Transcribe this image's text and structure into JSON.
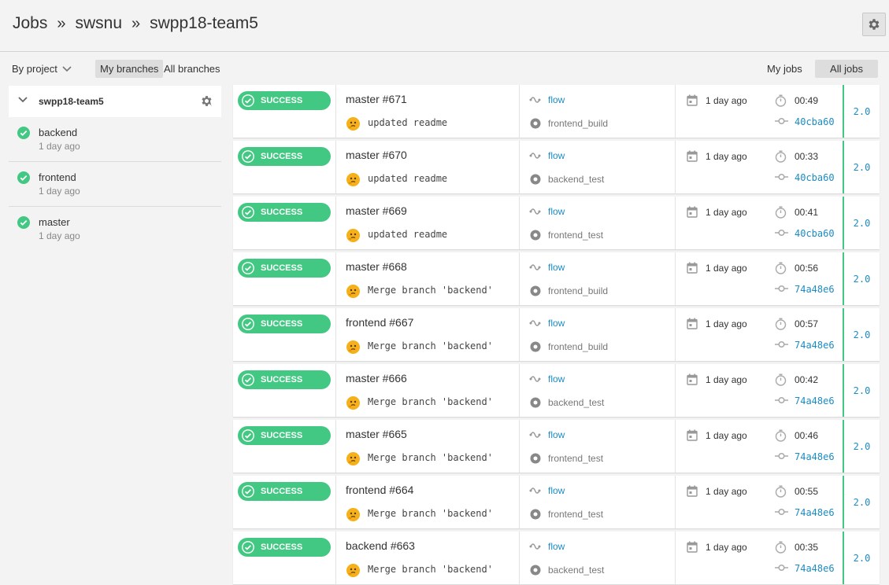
{
  "breadcrumb": [
    "Jobs",
    "swsnu",
    "swpp18-team5"
  ],
  "breadcrumb_sep": "»",
  "filters": {
    "by_project": "By project",
    "my_branches": "My branches",
    "all_branches": "All branches",
    "my_jobs": "My jobs",
    "all_jobs": "All jobs"
  },
  "sidebar": {
    "project": "swpp18-team5",
    "branches": [
      {
        "name": "backend",
        "time": "1 day ago"
      },
      {
        "name": "frontend",
        "time": "1 day ago"
      },
      {
        "name": "master",
        "time": "1 day ago"
      }
    ]
  },
  "colors": {
    "success": "#42c882",
    "link": "#1b8bc2"
  },
  "jobs": [
    {
      "status": "SUCCESS",
      "title": "master #671",
      "commit": "updated readme",
      "flow": "flow",
      "stage": "frontend_build",
      "date": "1 day ago",
      "duration": "00:49",
      "sha": "40cba60",
      "version": "2.0"
    },
    {
      "status": "SUCCESS",
      "title": "master #670",
      "commit": "updated readme",
      "flow": "flow",
      "stage": "backend_test",
      "date": "1 day ago",
      "duration": "00:33",
      "sha": "40cba60",
      "version": "2.0"
    },
    {
      "status": "SUCCESS",
      "title": "master #669",
      "commit": "updated readme",
      "flow": "flow",
      "stage": "frontend_test",
      "date": "1 day ago",
      "duration": "00:41",
      "sha": "40cba60",
      "version": "2.0"
    },
    {
      "status": "SUCCESS",
      "title": "master #668",
      "commit": "Merge branch 'backend'",
      "flow": "flow",
      "stage": "frontend_build",
      "date": "1 day ago",
      "duration": "00:56",
      "sha": "74a48e6",
      "version": "2.0"
    },
    {
      "status": "SUCCESS",
      "title": "frontend #667",
      "commit": "Merge branch 'backend'",
      "flow": "flow",
      "stage": "frontend_build",
      "date": "1 day ago",
      "duration": "00:57",
      "sha": "74a48e6",
      "version": "2.0"
    },
    {
      "status": "SUCCESS",
      "title": "master #666",
      "commit": "Merge branch 'backend'",
      "flow": "flow",
      "stage": "backend_test",
      "date": "1 day ago",
      "duration": "00:42",
      "sha": "74a48e6",
      "version": "2.0"
    },
    {
      "status": "SUCCESS",
      "title": "master #665",
      "commit": "Merge branch 'backend'",
      "flow": "flow",
      "stage": "frontend_test",
      "date": "1 day ago",
      "duration": "00:46",
      "sha": "74a48e6",
      "version": "2.0"
    },
    {
      "status": "SUCCESS",
      "title": "frontend #664",
      "commit": "Merge branch 'backend'",
      "flow": "flow",
      "stage": "frontend_test",
      "date": "1 day ago",
      "duration": "00:55",
      "sha": "74a48e6",
      "version": "2.0"
    },
    {
      "status": "SUCCESS",
      "title": "backend #663",
      "commit": "Merge branch 'backend'",
      "flow": "flow",
      "stage": "backend_test",
      "date": "1 day ago",
      "duration": "00:35",
      "sha": "74a48e6",
      "version": "2.0"
    }
  ]
}
